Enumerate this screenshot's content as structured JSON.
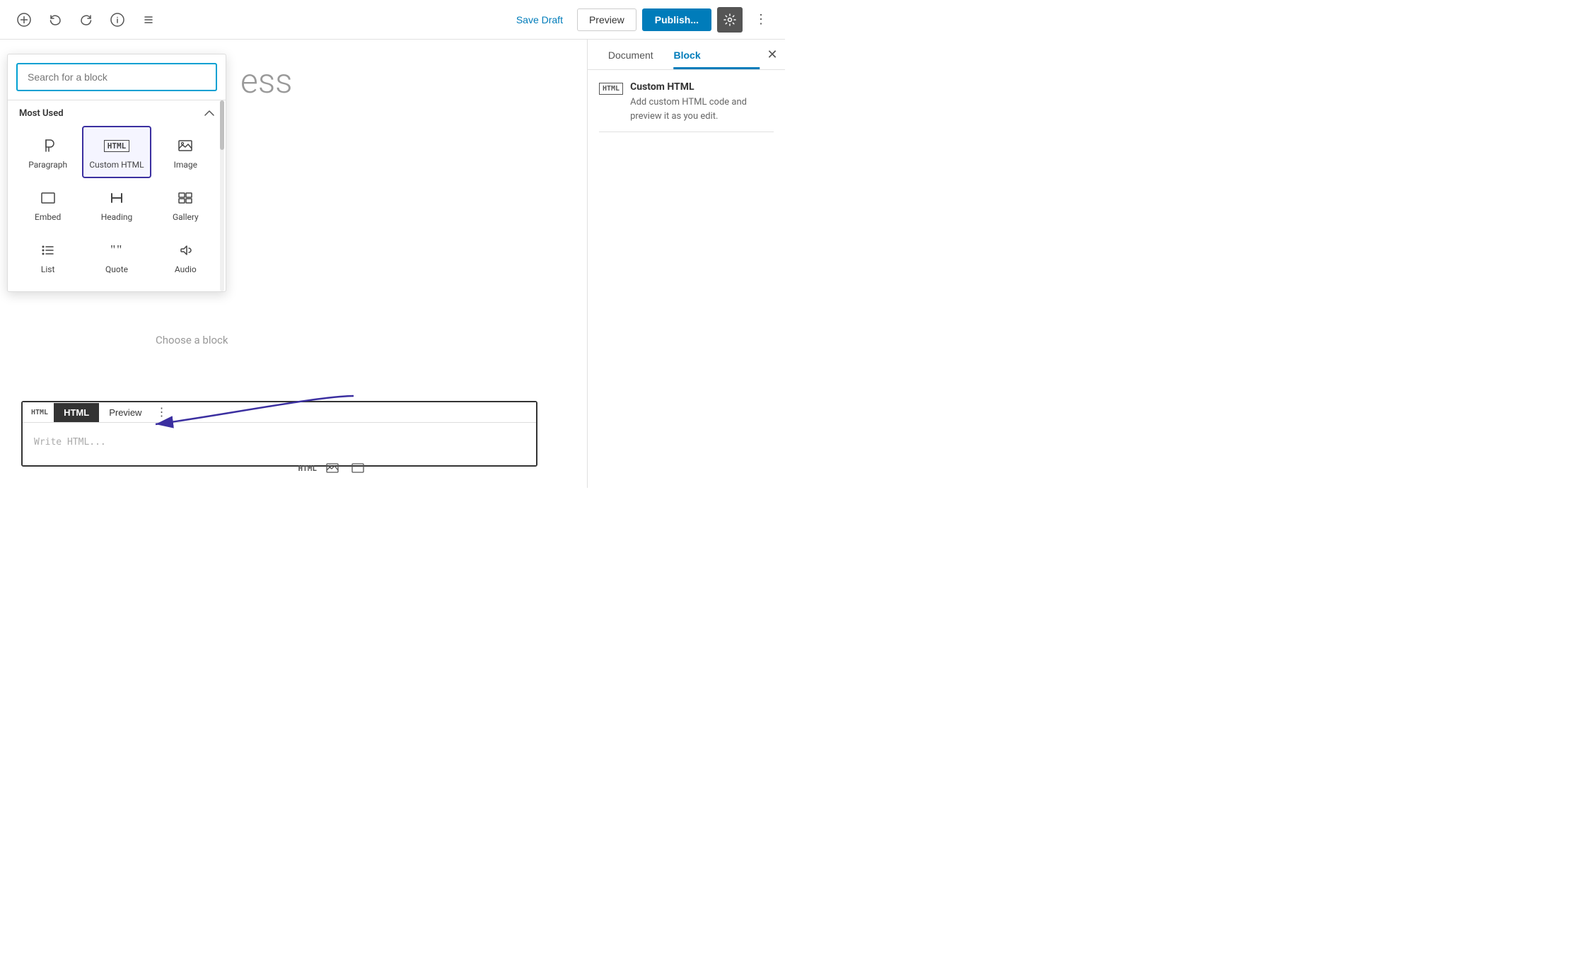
{
  "toolbar": {
    "save_draft_label": "Save Draft",
    "preview_label": "Preview",
    "publish_label": "Publish...",
    "settings_icon": "⚙",
    "more_icon": "⋮",
    "undo_icon": "↩",
    "redo_icon": "↪",
    "add_icon": "+",
    "info_icon": "ℹ",
    "list_icon": "≡"
  },
  "block_inserter": {
    "search_placeholder": "Search for a block",
    "section_title": "Most Used",
    "blocks": [
      {
        "id": "paragraph",
        "label": "Paragraph",
        "icon": "¶"
      },
      {
        "id": "custom-html",
        "label": "Custom HTML",
        "icon": "HTML",
        "selected": true
      },
      {
        "id": "image",
        "label": "Image",
        "icon": "🖼"
      },
      {
        "id": "embed",
        "label": "Embed",
        "icon": "□"
      },
      {
        "id": "heading",
        "label": "Heading",
        "icon": "T"
      },
      {
        "id": "gallery",
        "label": "Gallery",
        "icon": "⊞"
      },
      {
        "id": "list",
        "label": "List",
        "icon": "≡"
      },
      {
        "id": "quote",
        "label": "Quote",
        "icon": "❝"
      },
      {
        "id": "audio",
        "label": "Audio",
        "icon": "♪"
      }
    ]
  },
  "editor": {
    "title_placeholder": "ess",
    "choose_block_text": "Choose a block",
    "html_block": {
      "label_small": "HTML",
      "tab_html": "HTML",
      "tab_preview": "Preview",
      "more_icon": "⋮",
      "placeholder": "Write HTML..."
    }
  },
  "sidebar": {
    "document_tab": "Document",
    "block_tab": "Block",
    "close_icon": "✕",
    "block_info": {
      "badge": "HTML",
      "name": "Custom HTML",
      "description": "Add custom HTML code and preview it as you edit."
    }
  },
  "bottom_toolbar": {
    "html_label": "HTML",
    "image_icon": "🖼",
    "fullscreen_icon": "□"
  }
}
